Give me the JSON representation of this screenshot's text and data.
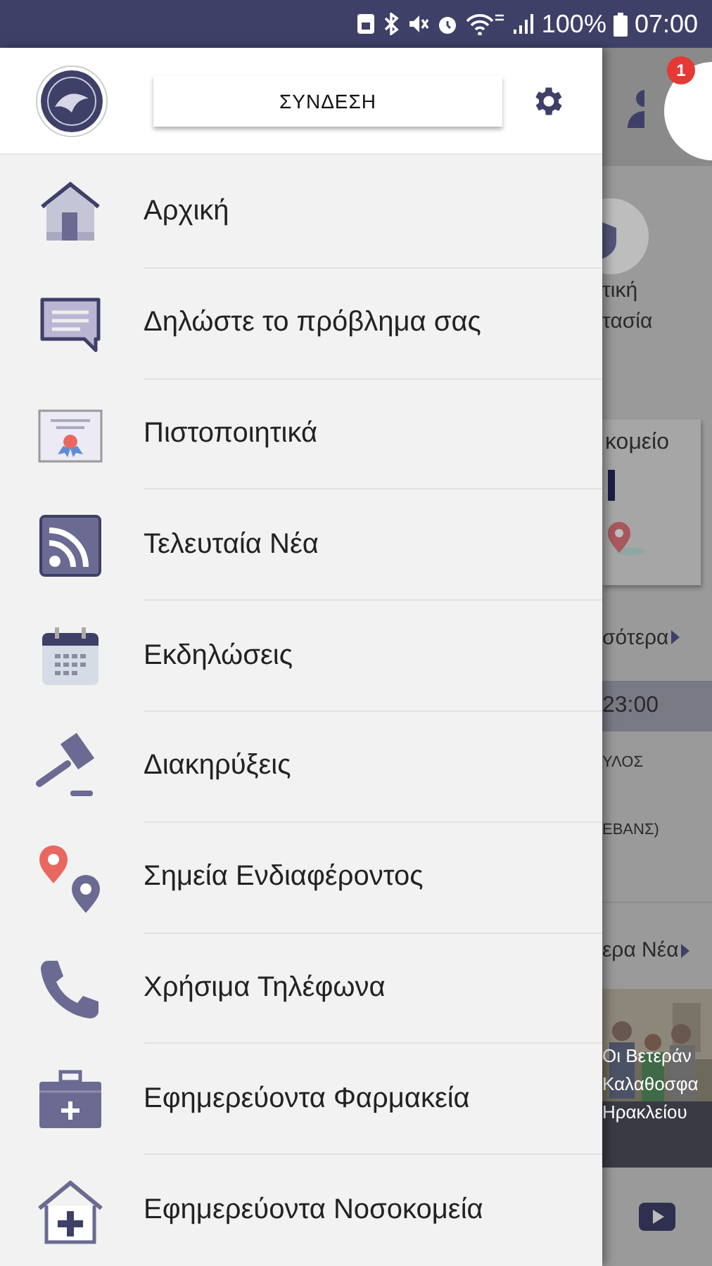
{
  "status_bar": {
    "battery": "100%",
    "time": "07:00"
  },
  "drawer": {
    "login_button": "ΣΥΝΔΕΣΗ",
    "items": [
      {
        "label": "Αρχική"
      },
      {
        "label": "Δηλώστε το πρόβλημα σας"
      },
      {
        "label": "Πιστοποιητικά"
      },
      {
        "label": "Τελευταία Νέα"
      },
      {
        "label": "Εκδηλώσεις"
      },
      {
        "label": "Διακηρύξεις"
      },
      {
        "label": "Σημεία Ενδιαφέροντος"
      },
      {
        "label": "Χρήσιμα Τηλέφωνα"
      },
      {
        "label": "Εφημερεύοντα Φαρμακεία"
      },
      {
        "label": "Εφημερεύοντα Νοσοκομεία"
      }
    ]
  },
  "background_screen": {
    "notification_badge": "1",
    "service_label": [
      "τική",
      "τασία"
    ],
    "card_title": "κομείο",
    "more_link": "σότερα",
    "event_time": "23:00",
    "events": [
      "ΥΛΟΣ",
      "ΕΒΑΝΣ)"
    ],
    "news_link": "ερα Νέα",
    "news_caption": [
      "Οι Βετεράν",
      "Καλαθοσφα",
      "Ηρακλείου"
    ]
  }
}
